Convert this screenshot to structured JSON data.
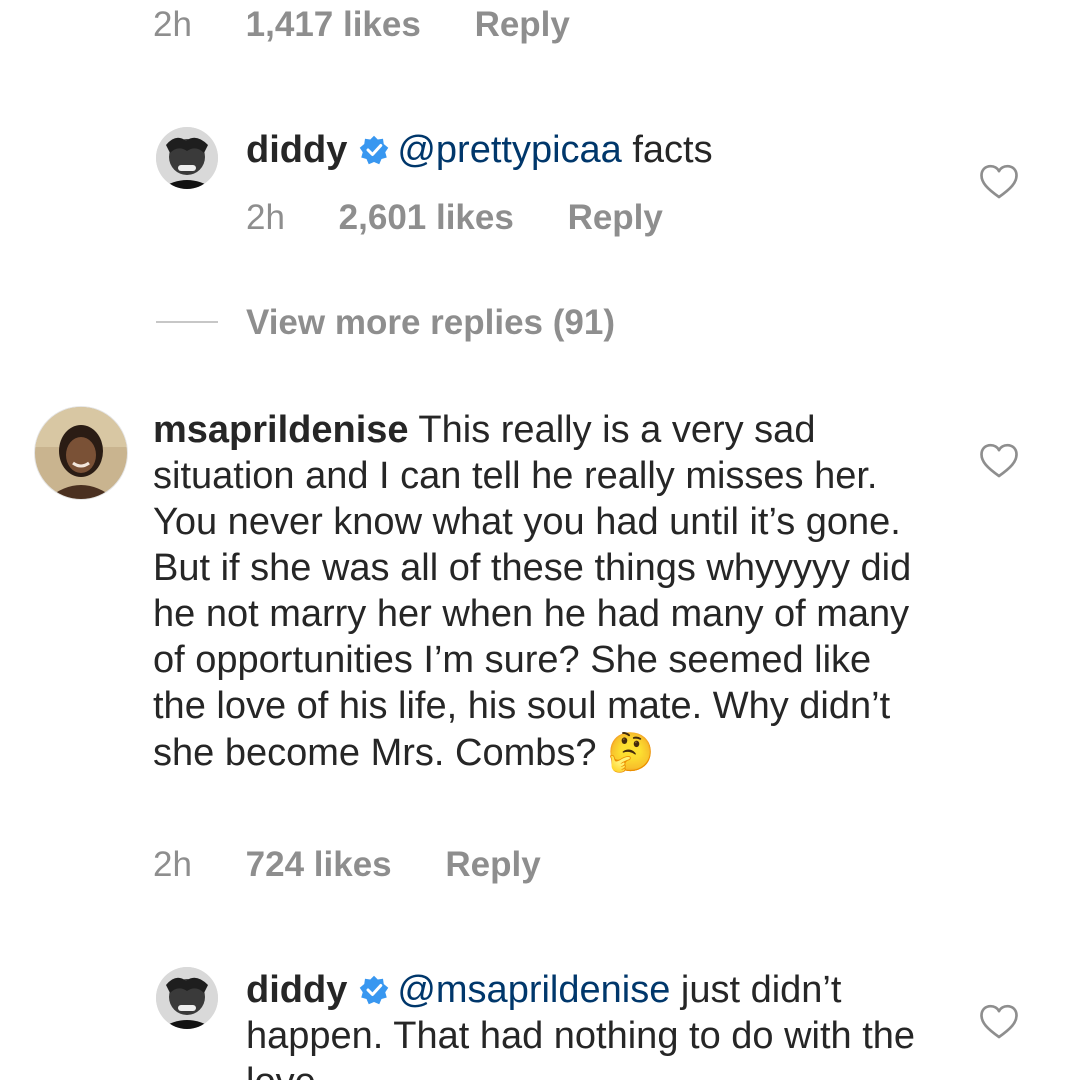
{
  "colors": {
    "text": "#262626",
    "muted": "#8e8e8e",
    "mention": "#00376b",
    "verified": "#3897f0"
  },
  "top_meta": {
    "time": "2h",
    "likes": "1,417 likes",
    "reply": "Reply"
  },
  "reply1": {
    "user": "diddy",
    "verified_icon": "verified-badge-icon",
    "mention": "@prettypicaa",
    "text": " facts",
    "time": "2h",
    "likes": "2,601 likes",
    "reply": "Reply"
  },
  "view_more": {
    "label": "View more replies (91)"
  },
  "comment": {
    "user": "msaprildenise",
    "text": " This really is a very sad situation and I can tell he really misses her. You never know what you had until it’s gone. But if she was all of these things whyyyyy did he not marry her when he had many of many of opportunities I’m sure? She seemed like the love of his life, his soul mate. Why didn’t she become Mrs. Combs? ",
    "emoji": "🤔",
    "time": "2h",
    "likes": "724 likes",
    "reply": "Reply"
  },
  "reply2": {
    "user": "diddy",
    "mention": "@msaprildenise",
    "text": " just didn’t happen. That had nothing to do with the love"
  }
}
